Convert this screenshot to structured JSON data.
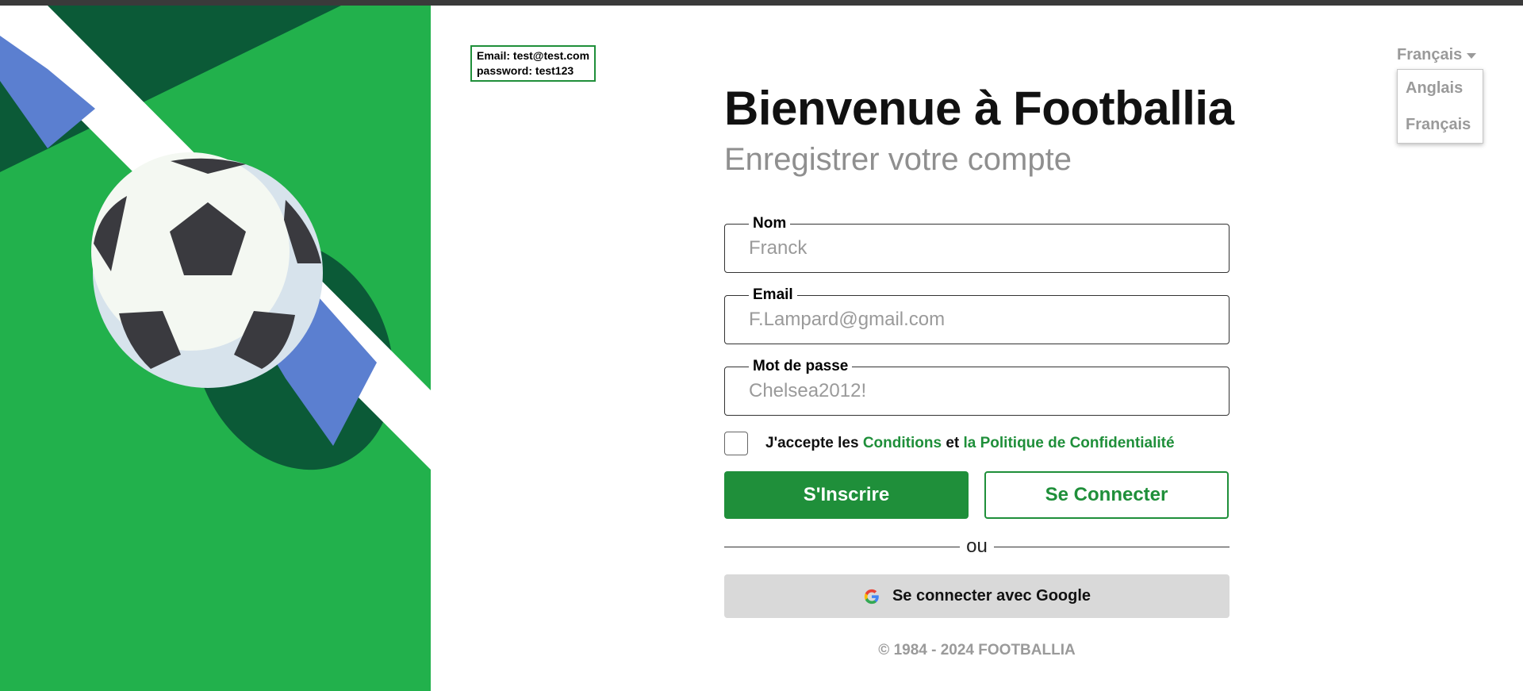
{
  "hint": {
    "email_line": "Email: test@test.com",
    "password_line": "password: test123"
  },
  "language": {
    "selected": "Français",
    "options": [
      "Anglais",
      "Français"
    ]
  },
  "header": {
    "title": "Bienvenue à Footballia",
    "subtitle": "Enregistrer votre compte"
  },
  "form": {
    "name_label": "Nom",
    "name_placeholder": "Franck",
    "email_label": "Email",
    "email_placeholder": "F.Lampard@gmail.com",
    "password_label": "Mot de passe",
    "password_placeholder": "Chelsea2012!",
    "consent_prefix": "J'accepte les",
    "consent_terms": "Conditions",
    "consent_and": "et",
    "consent_privacy": "la Politique de Confidentialité"
  },
  "buttons": {
    "signup": "S'Inscrire",
    "login": "Se Connecter",
    "divider": "ou",
    "google": "Se connecter avec Google"
  },
  "footer": {
    "copyright": "© 1984 - 2024 FOOTBALLIA"
  },
  "colors": {
    "brand_green": "#1f8f3a",
    "panel_green": "#22b14c",
    "dark_green": "#0b5a37",
    "stripe_blue": "#5b7fd0"
  },
  "icons": {
    "google": "google-icon",
    "dropdown": "chevron-down-icon",
    "illustration": "soccer-ball-illustration"
  }
}
